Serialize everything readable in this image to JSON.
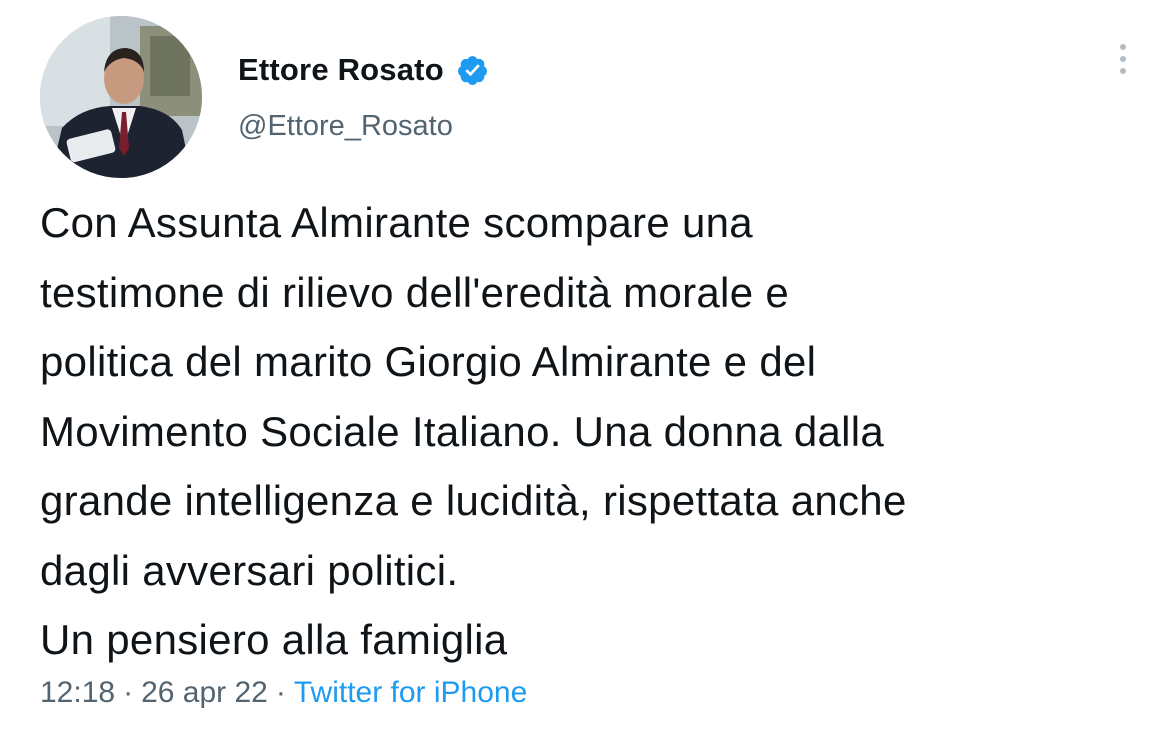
{
  "author": {
    "display_name": "Ettore Rosato",
    "handle": "@Ettore_Rosato",
    "verified": true,
    "avatar_icon": "profile-photo",
    "verified_color": "#1d9bf0"
  },
  "tweet": {
    "lines": [
      "Con Assunta Almirante scompare una",
      "testimone di rilievo dell'eredità morale e",
      "politica del marito Giorgio Almirante e del",
      "Movimento Sociale Italiano. Una donna dalla",
      "grande intelligenza e lucidità, rispettata anche",
      "dagli avversari politici.",
      "Un pensiero alla famiglia"
    ]
  },
  "meta": {
    "time": "12:18",
    "separator": "·",
    "date": "26 apr 22",
    "source": "Twitter for iPhone"
  },
  "menu": {
    "icon": "more-vertical-icon"
  }
}
